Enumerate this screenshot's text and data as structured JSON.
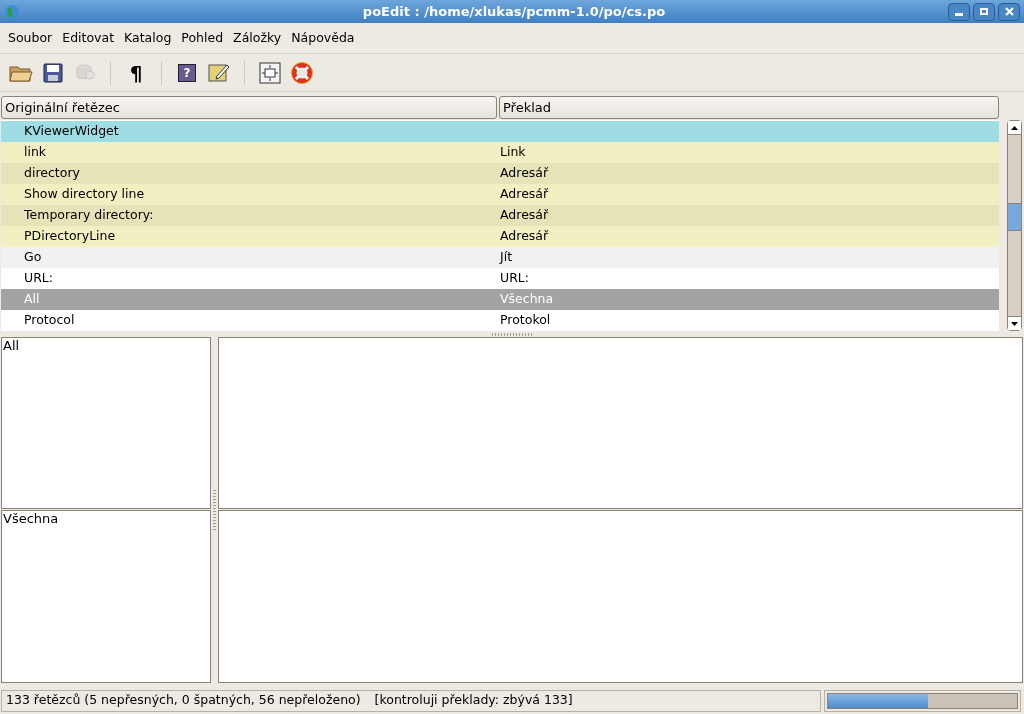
{
  "window": {
    "title": "poEdit : /home/xlukas/pcmm-1.0/po/cs.po"
  },
  "menu": [
    {
      "label": "Soubor"
    },
    {
      "label": "Editovat"
    },
    {
      "label": "Katalog"
    },
    {
      "label": "Pohled"
    },
    {
      "label": "Záložky"
    },
    {
      "label": "Nápověda"
    }
  ],
  "toolbar": [
    {
      "kind": "open",
      "disabled": false
    },
    {
      "kind": "save",
      "disabled": false
    },
    {
      "kind": "database",
      "disabled": true
    },
    {
      "kind": "separator"
    },
    {
      "kind": "pilcrow",
      "text": "¶",
      "disabled": false
    },
    {
      "kind": "separator"
    },
    {
      "kind": "help",
      "text": "?",
      "disabled": false
    },
    {
      "kind": "comment",
      "disabled": false
    },
    {
      "kind": "separator"
    },
    {
      "kind": "fit",
      "disabled": false
    },
    {
      "kind": "lifebuoy",
      "disabled": false
    }
  ],
  "table": {
    "columns": [
      "Originální řetězec",
      "Překlad"
    ],
    "rows": [
      {
        "original": "KViewerWidget",
        "translation": "",
        "kind": "untranslated",
        "selected": false
      },
      {
        "original": "link",
        "translation": "Link",
        "kind": "fuzzy",
        "selected": false
      },
      {
        "original": "directory",
        "translation": "Adresář",
        "kind": "fuzzy",
        "selected": false
      },
      {
        "original": "Show directory line",
        "translation": "Adresář",
        "kind": "fuzzy",
        "selected": false
      },
      {
        "original": "Temporary directory:",
        "translation": "Adresář",
        "kind": "fuzzy",
        "selected": false
      },
      {
        "original": "PDirectoryLine",
        "translation": "Adresář",
        "kind": "fuzzy",
        "selected": false
      },
      {
        "original": "Go",
        "translation": "Jít",
        "kind": "translated",
        "selected": false
      },
      {
        "original": "URL:",
        "translation": "URL:",
        "kind": "translated",
        "selected": false
      },
      {
        "original": "All",
        "translation": "Všechna",
        "kind": "translated",
        "selected": true
      },
      {
        "original": "Protocol",
        "translation": "Protokol",
        "kind": "translated",
        "selected": false
      }
    ]
  },
  "editor": {
    "source_text": "All",
    "translation_text": "Všechna"
  },
  "status_bar": {
    "summary": "133 řetězců (5 nepřesných, 0 špatných, 56 nepřeloženo)",
    "check": "[kontroluji překlady: zbývá 133]",
    "progress": {
      "level": 0.53
    }
  }
}
